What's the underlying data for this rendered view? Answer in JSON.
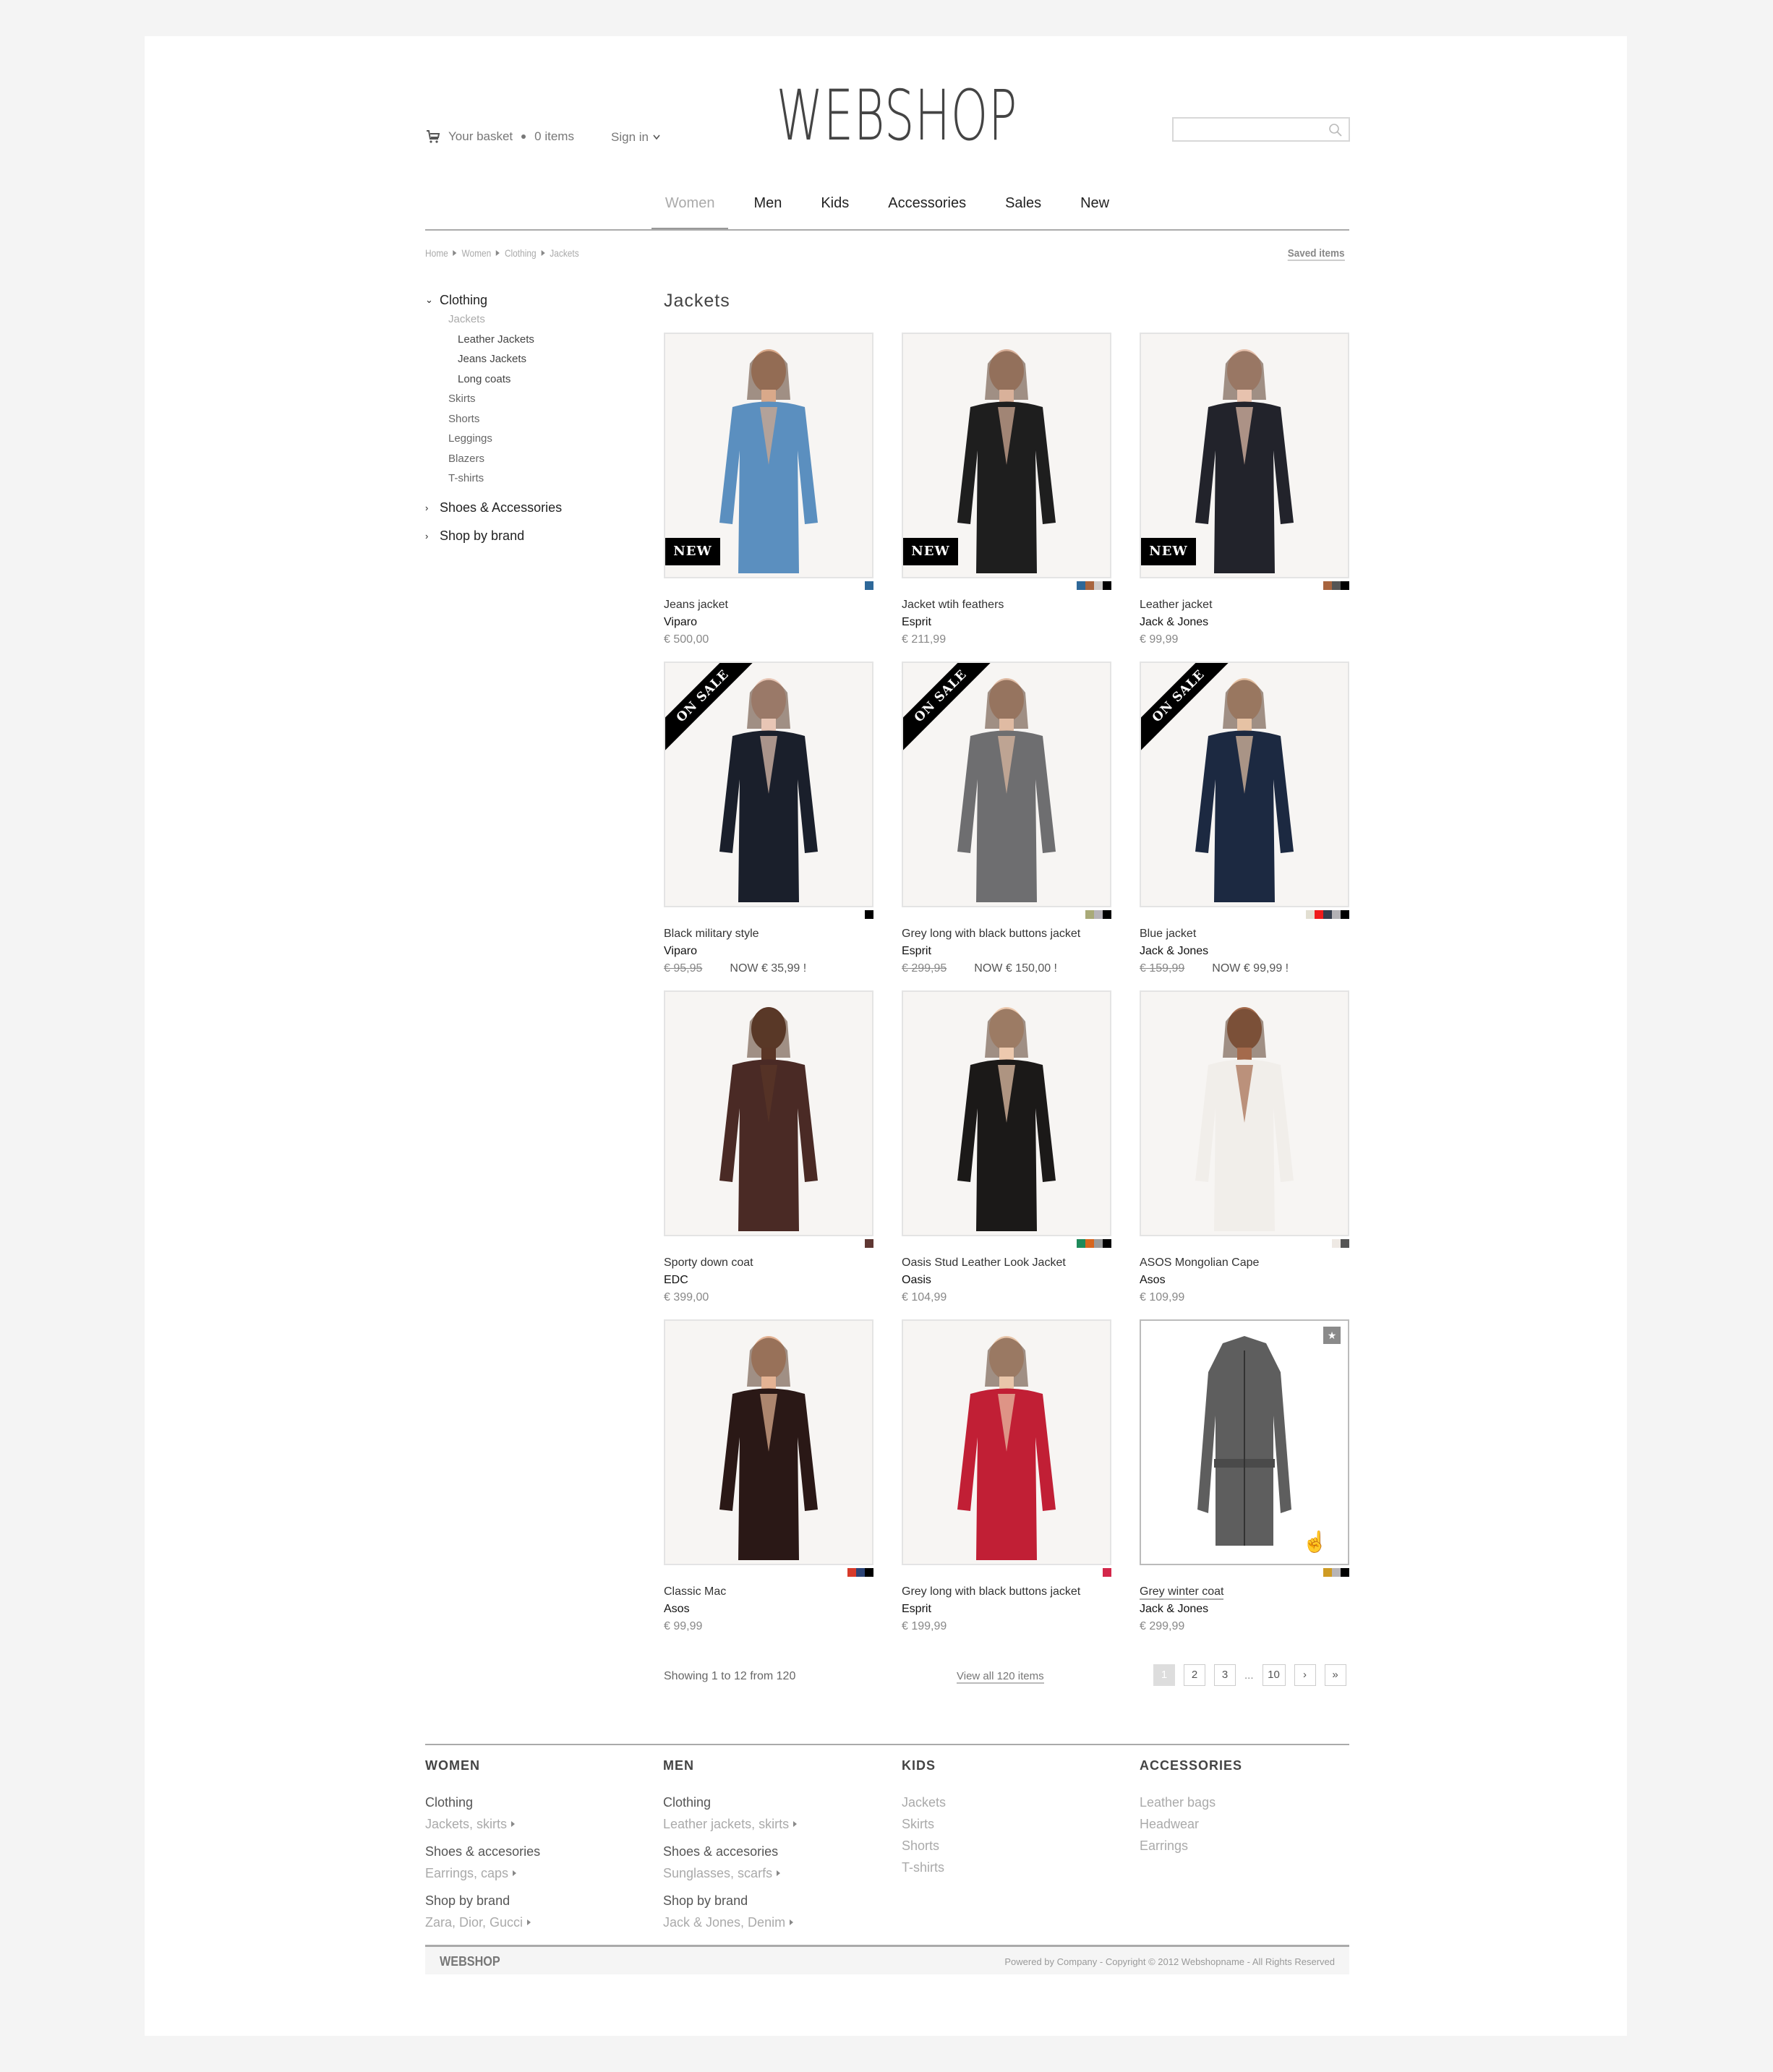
{
  "header": {
    "basket_label": "Your basket",
    "basket_count": "0 items",
    "signin_label": "Sign in",
    "logo": "WEBSHOP",
    "search_placeholder": ""
  },
  "nav": {
    "items": [
      {
        "label": "Women",
        "active": true
      },
      {
        "label": "Men"
      },
      {
        "label": "Kids"
      },
      {
        "label": "Accessories"
      },
      {
        "label": "Sales"
      },
      {
        "label": "New"
      }
    ]
  },
  "breadcrumb": [
    "Home",
    "Women",
    "Clothing",
    "Jackets"
  ],
  "saved_items_label": "Saved items",
  "sidebar": {
    "clothing": {
      "label": "Clothing",
      "subs": [
        {
          "label": "Jackets",
          "active": true,
          "children": [
            "Leather Jackets",
            "Jeans Jackets",
            "Long coats"
          ]
        },
        {
          "label": "Skirts"
        },
        {
          "label": "Shorts"
        },
        {
          "label": "Leggings"
        },
        {
          "label": "Blazers"
        },
        {
          "label": "T-shirts"
        }
      ]
    },
    "shoes": "Shoes & Accessories",
    "brand": "Shop by brand"
  },
  "page_title": "Jackets",
  "badges": {
    "new": "NEW",
    "sale": "ON SALE"
  },
  "products": [
    {
      "name": "Jeans jacket",
      "brand": "Viparo",
      "price": "€ 500,00",
      "badge": "new",
      "swatches": [
        "#2e6899"
      ],
      "garment": "#5b8fbf",
      "skin": "#d9a98a"
    },
    {
      "name": "Jacket wtih feathers",
      "brand": "Esprit",
      "price": "€ 211,99",
      "badge": "new",
      "swatches": [
        "#2e6899",
        "#a8643e",
        "#cfcccb",
        "#000000"
      ],
      "garment": "#1e1e1e",
      "skin": "#d9b19a"
    },
    {
      "name": "Leather jacket",
      "brand": "Jack & Jones",
      "price": "€ 99,99",
      "badge": "new",
      "swatches": [
        "#a8643e",
        "#555555",
        "#000000"
      ],
      "garment": "#22232b",
      "skin": "#e7c2ae"
    },
    {
      "name": "Black military style",
      "brand": "Viparo",
      "old_price": "€ 95,95",
      "now_price": "NOW € 35,99 !",
      "badge": "sale",
      "swatches": [
        "#000000"
      ],
      "garment": "#1a1f2b",
      "skin": "#e8c6b5"
    },
    {
      "name": "Grey long with black buttons jacket",
      "brand": "Esprit",
      "old_price": "€ 299,95",
      "now_price": "NOW € 150,00 !",
      "badge": "sale",
      "swatches": [
        "#a9aa78",
        "#b6b3b8",
        "#000000"
      ],
      "garment": "#6e6e70",
      "skin": "#e0bba3"
    },
    {
      "name": "Blue jacket",
      "brand": "Jack & Jones",
      "old_price": "€ 159,99",
      "now_price": "NOW € 99,99 !",
      "badge": "sale",
      "swatches": [
        "#e2dfd2",
        "#ef1b1b",
        "#353c4c",
        "#b3b1b5",
        "#000000"
      ],
      "garment": "#1c2941",
      "skin": "#e6c2a4"
    },
    {
      "name": "Sporty down coat",
      "brand": "EDC",
      "price": "€ 399,00",
      "swatches": [
        "#5f3733"
      ],
      "garment": "#4a2a25",
      "skin": "#5a3626"
    },
    {
      "name": "Oasis Stud Leather Look Jacket",
      "brand": "Oasis",
      "price": "€ 104,99",
      "swatches": [
        "#1e8a5a",
        "#d8661e",
        "#9a9a9a",
        "#000000"
      ],
      "garment": "#1b1918",
      "skin": "#edc9ae"
    },
    {
      "name": "ASOS Mongolian Cape",
      "brand": "Asos",
      "price": "€ 109,99",
      "swatches": [
        "#eee9e4",
        "#555555"
      ],
      "garment": "#f1eeea",
      "skin": "#a46a4c"
    },
    {
      "name": "Classic Mac",
      "brand": "Asos",
      "price": "€ 99,99",
      "swatches": [
        "#d73a2a",
        "#2c4476",
        "#000000"
      ],
      "garment": "#2a1816",
      "skin": "#e4b394"
    },
    {
      "name": "Grey long with black buttons jacket",
      "brand": "Esprit",
      "price": "€ 199,99",
      "swatches": [
        "#d3274a"
      ],
      "garment": "#c11f35",
      "skin": "#e9c6aa"
    },
    {
      "name": "Grey winter coat",
      "brand": "Jack & Jones",
      "price": "€ 299,99",
      "hover": true,
      "star": true,
      "swatches": [
        "#cf9b23",
        "#b7b4b6",
        "#000000"
      ],
      "garment": "#5e5e5e"
    }
  ],
  "pagination": {
    "showing": "Showing 1 to 12 from 120",
    "view_all": "View all 120 items",
    "pages": [
      "1",
      "2",
      "3"
    ],
    "ellipsis": "...",
    "last_page": "10",
    "next": "›",
    "last": "»",
    "current": "1"
  },
  "footer": {
    "columns": [
      {
        "title": "WOMEN",
        "groups": [
          {
            "label": "Clothing",
            "link": "Jackets, skirts"
          },
          {
            "label": "Shoes & accesories",
            "link": "Earrings, caps"
          },
          {
            "label": "Shop by brand",
            "link": "Zara, Dior, Gucci"
          }
        ]
      },
      {
        "title": "MEN",
        "groups": [
          {
            "label": "Clothing",
            "link": "Leather jackets, skirts"
          },
          {
            "label": "Shoes & accesories",
            "link": "Sunglasses, scarfs"
          },
          {
            "label": "Shop by brand",
            "link": "Jack & Jones, Denim"
          }
        ]
      },
      {
        "title": "KIDS",
        "links": [
          "Jackets",
          "Skirts",
          "Shorts",
          "T-shirts"
        ]
      },
      {
        "title": "ACCESSORIES",
        "links": [
          "Leather bags",
          "Headwear",
          "Earrings"
        ]
      }
    ],
    "bottom_logo": "WEBSHOP",
    "copyright": "Powered by Company - Copyright © 2012 Webshopname - All Rights Reserved"
  }
}
